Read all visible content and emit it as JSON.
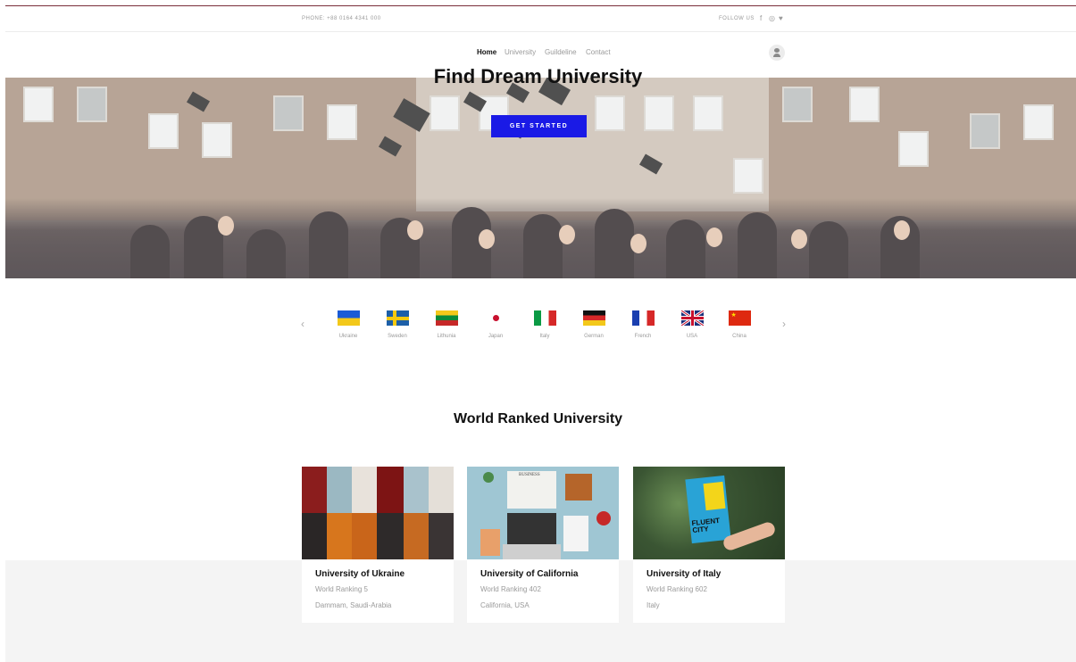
{
  "topbar": {
    "phone": "PHONE: +88 0164 4341 000",
    "follow": "FOLLOW US",
    "social_icons": [
      "facebook-icon",
      "instagram-icon",
      "twitter-icon"
    ],
    "social_glyphs": [
      "f",
      "◎",
      "♥"
    ]
  },
  "nav": {
    "items": [
      "Home",
      "University",
      "Guildeline",
      "Contact"
    ],
    "active": "Home"
  },
  "hero": {
    "title": "Find Dream University",
    "button": "GET STARTED",
    "button_color": "#1a1ae6"
  },
  "countries": [
    {
      "label": "Ukraine"
    },
    {
      "label": "Sweden"
    },
    {
      "label": "Lithunia"
    },
    {
      "label": "Japan"
    },
    {
      "label": "Italy"
    },
    {
      "label": "German"
    },
    {
      "label": "French"
    },
    {
      "label": "USA"
    },
    {
      "label": "China"
    }
  ],
  "carousel": {
    "prev": "‹",
    "next": "›"
  },
  "section": {
    "title": "World Ranked University"
  },
  "cards": [
    {
      "name": "University of Ukraine",
      "rank": "World Ranking 5",
      "location": "Dammam, Saudi-Arabia"
    },
    {
      "name": "University of California",
      "rank": "World Ranking 402",
      "location": "California, USA"
    },
    {
      "name": "University of Italy",
      "rank": "World Ranking 602",
      "location": "Italy"
    }
  ],
  "card_images": {
    "card2_text": "BUSINESS",
    "card3_book": "FLUENT CITY"
  }
}
